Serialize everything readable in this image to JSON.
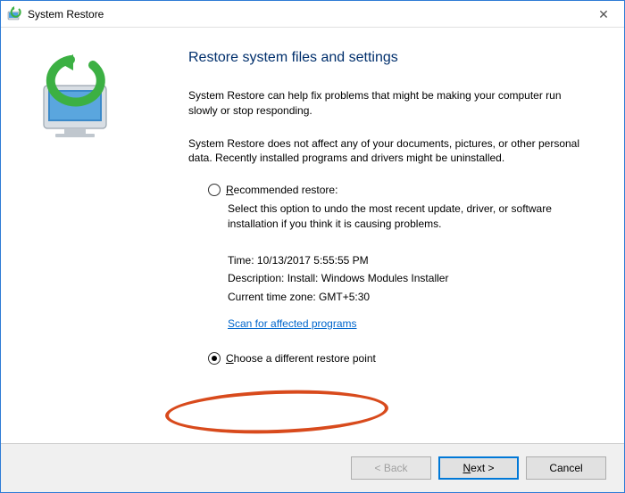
{
  "window": {
    "title": "System Restore"
  },
  "heading": "Restore system files and settings",
  "intro1": "System Restore can help fix problems that might be making your computer run slowly or stop responding.",
  "intro2": "System Restore does not affect any of your documents, pictures, or other personal data. Recently installed programs and drivers might be uninstalled.",
  "option_recommended": {
    "label_prefix": "R",
    "label_rest": "ecommended restore:",
    "desc": "Select this option to undo the most recent update, driver, or software installation if you think it is causing problems.",
    "time_label": "Time: ",
    "time_value": "10/13/2017 5:55:55 PM",
    "desc_label": "Description: ",
    "desc_value": "Install: Windows Modules Installer",
    "tz_label": "Current time zone: ",
    "tz_value": "GMT+5:30",
    "scan_link": "Scan for affected programs"
  },
  "option_choose": {
    "label_prefix": "C",
    "label_rest": "hoose a different restore point"
  },
  "footer": {
    "back": "< Back",
    "next": "Next >",
    "cancel": "Cancel"
  }
}
